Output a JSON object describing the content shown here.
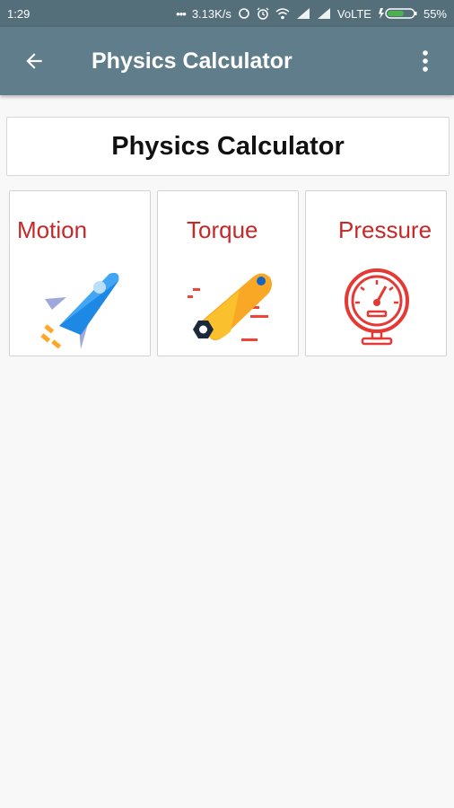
{
  "status_bar": {
    "time": "1:29",
    "network_speed": "3.13K/s",
    "network": "VoLTE",
    "battery": "55%"
  },
  "app_bar": {
    "title": "Physics Calculator"
  },
  "header_card": {
    "title": "Physics Calculator"
  },
  "tiles": [
    {
      "label": "Motion",
      "icon": "rocket-icon"
    },
    {
      "label": "Torque",
      "icon": "wrench-icon"
    },
    {
      "label": "Pressure",
      "icon": "pressure-gauge-icon"
    }
  ],
  "colors": {
    "app_bar": "#607d8b",
    "status_bar": "#546e7a",
    "tile_label": "#c62828",
    "background": "#f8f8f8"
  }
}
